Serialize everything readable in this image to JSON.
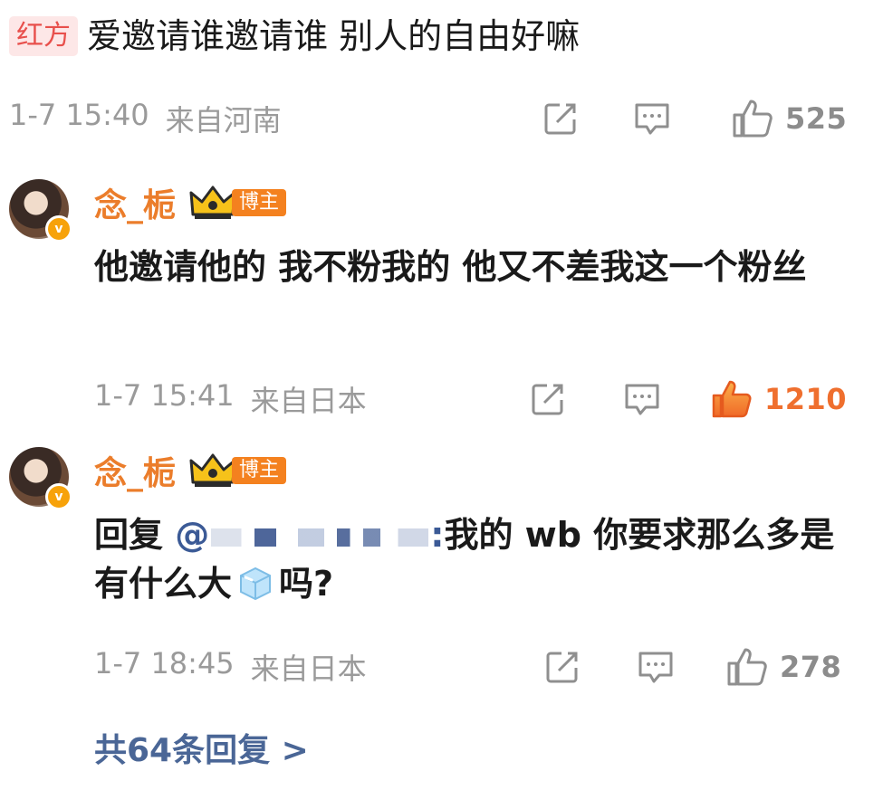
{
  "top_comment": {
    "side_tag": "红方",
    "text": "爱邀请谁邀请谁 别人的自由好嘛",
    "time": "1-7 15:40",
    "location": "来自河南",
    "likes": "525"
  },
  "replies": [
    {
      "username": "念_栀",
      "badge_label": "博主",
      "text": "他邀请他的 我不粉我的 他又不差我这一个粉丝",
      "time": "1-7 15:41",
      "location": "来自日本",
      "likes": "1210",
      "liked": true
    },
    {
      "username": "念_栀",
      "badge_label": "博主",
      "text_prefix": "回复",
      "mention_start": "@",
      "mention_end": ":",
      "text_main": "我的 wb 你要求那么多是有什么大",
      "text_suffix": "吗?",
      "time": "1-7 18:45",
      "location": "来自日本",
      "likes": "278",
      "liked": false
    }
  ],
  "more_replies": "共64条回复 >",
  "icons": {
    "share": "share-icon",
    "comment": "comment-icon",
    "like": "thumbs-up-icon",
    "verified": "verified-badge-icon",
    "crown": "crown-badge-icon",
    "ice": "ice-emoji-icon"
  },
  "colors": {
    "username": "#eb7d2b",
    "blogger_tag": "#f4811f",
    "side_tag_bg": "#fde7e7",
    "side_tag_text": "#e8504c",
    "meta_gray": "#9a9a9a",
    "like_active": "#ef6f2e",
    "link_blue": "#4a6696"
  }
}
